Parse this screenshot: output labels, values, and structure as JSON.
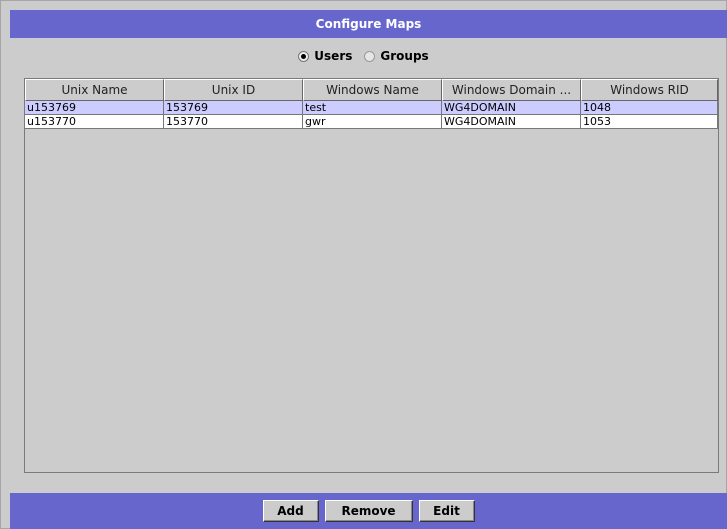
{
  "window": {
    "title": "Configure Maps"
  },
  "mode": {
    "options": [
      {
        "label": "Users",
        "checked": true
      },
      {
        "label": "Groups",
        "checked": false
      }
    ]
  },
  "table": {
    "columns": [
      "Unix Name",
      "Unix ID",
      "Windows Name",
      "Windows Domain ...",
      "Windows RID"
    ],
    "rows": [
      {
        "selected": true,
        "cells": [
          "u153769",
          "153769",
          "test",
          "WG4DOMAIN",
          "1048"
        ]
      },
      {
        "selected": false,
        "cells": [
          "u153770",
          "153770",
          "gwr",
          "WG4DOMAIN",
          "1053"
        ]
      }
    ]
  },
  "buttons": {
    "add": "Add",
    "remove": "Remove",
    "edit": "Edit"
  },
  "colors": {
    "accent": "#6666cc",
    "background": "#cccccc",
    "selection": "#ccccff"
  }
}
